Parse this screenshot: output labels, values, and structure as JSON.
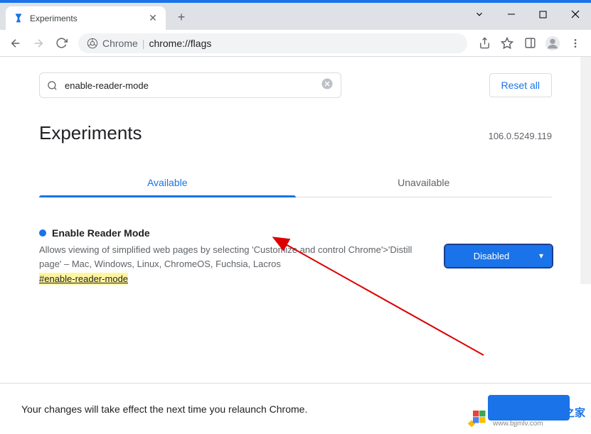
{
  "window": {
    "tab_title": "Experiments",
    "address_label_prefix": "Chrome",
    "address_url": "chrome://flags"
  },
  "search": {
    "query": "enable-reader-mode",
    "reset_label": "Reset all"
  },
  "page": {
    "title": "Experiments",
    "version": "106.0.5249.119"
  },
  "tabs": {
    "available": "Available",
    "unavailable": "Unavailable"
  },
  "flag": {
    "title": "Enable Reader Mode",
    "description": "Allows viewing of simplified web pages by selecting 'Customize and control Chrome'>'Distill page' – Mac, Windows, Linux, ChromeOS, Fuchsia, Lacros",
    "hash": "#enable-reader-mode",
    "selected": "Disabled"
  },
  "footer": {
    "message": "Your changes will take effect the next time you relaunch Chrome."
  },
  "watermark": {
    "brand": "Windows 系统之家",
    "url": "www.bjjmlv.com"
  }
}
